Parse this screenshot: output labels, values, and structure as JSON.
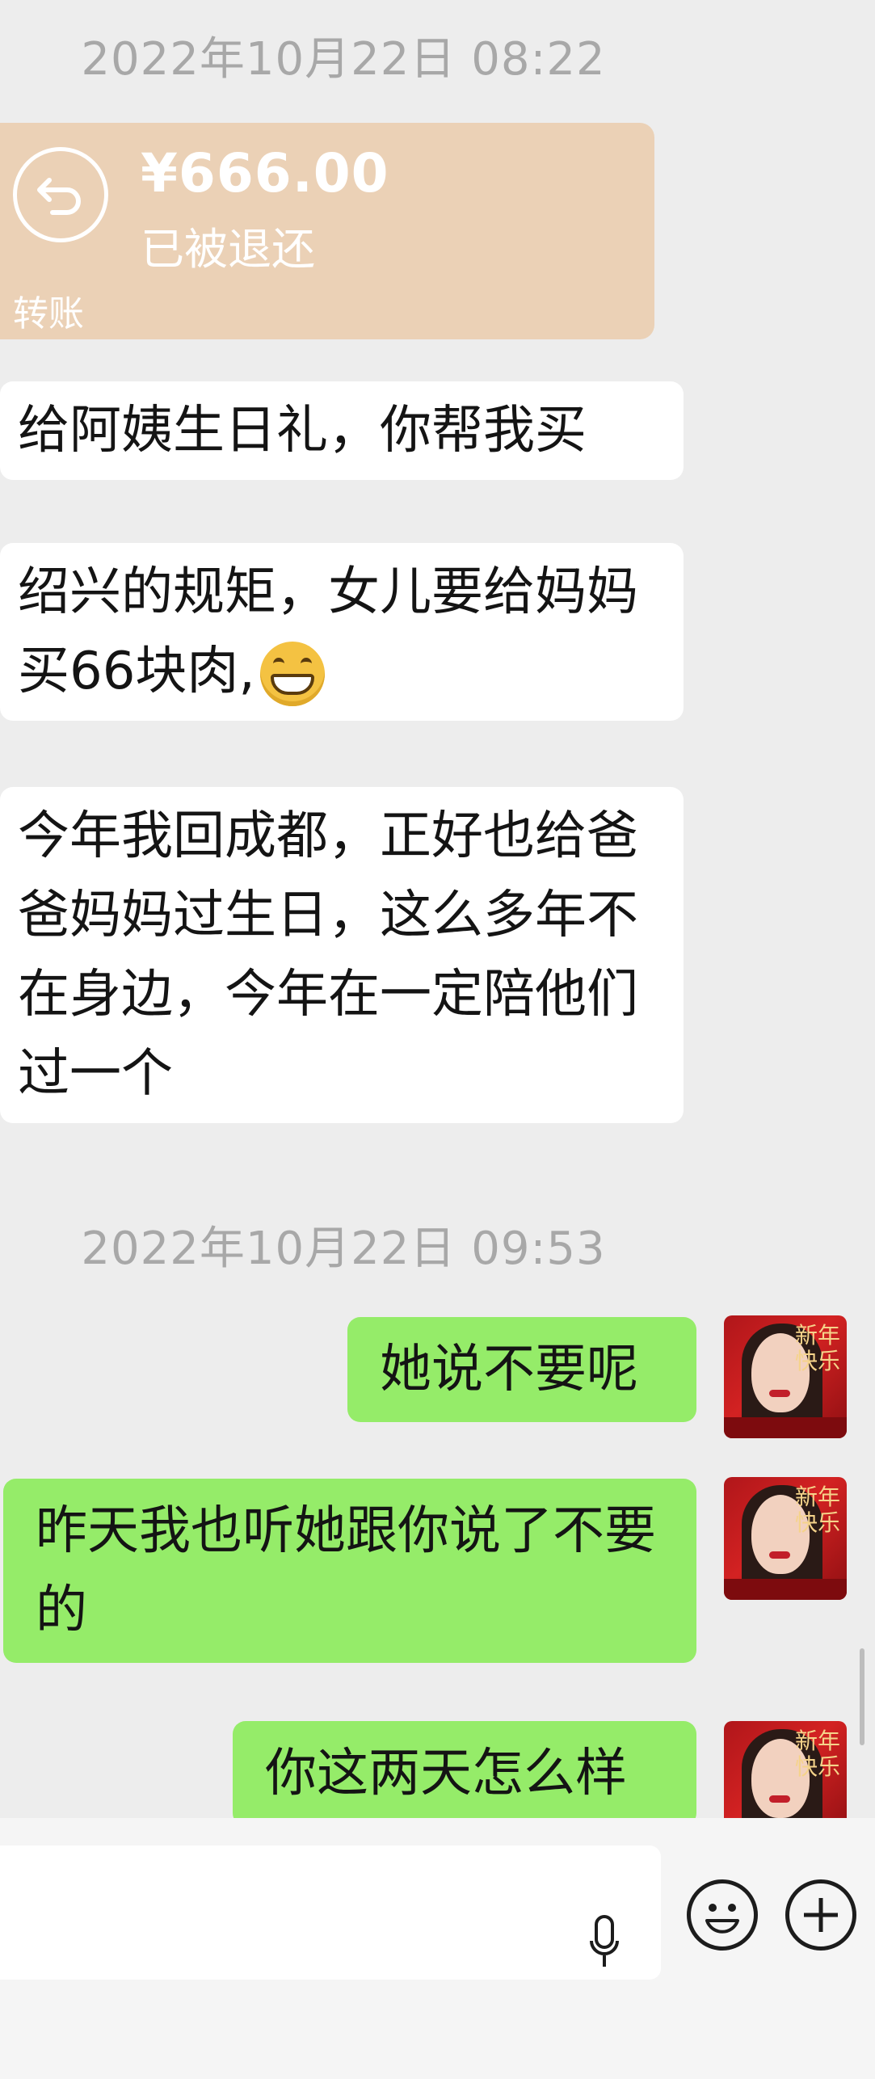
{
  "chat": {
    "timestamp1": "2022年10月22日 08:22",
    "timestamp2": "2022年10月22日 09:53",
    "transfer": {
      "amount": "¥666.00",
      "status": "已被退还",
      "label": "转账"
    },
    "incoming": [
      "给阿姨生日礼，你帮我买",
      "绍兴的规矩，女儿要给妈妈买66块肉,",
      "今年我回成都，正好也给爸爸妈妈过生日，这么多年不在身边，今年在一定陪他们过一个"
    ],
    "outgoing": [
      "她说不要呢",
      "昨天我也听她跟你说了不要的",
      "你这两天怎么样"
    ],
    "avatar_text": [
      "新年",
      "快乐"
    ]
  },
  "icons": {
    "transfer_return": "return-arrow-icon",
    "grin_emoji": "grinning-emoji-icon",
    "mic": "microphone-icon",
    "emoji_button": "smiley-icon",
    "add_button": "plus-icon"
  },
  "colors": {
    "background": "#ededed",
    "outgoing_bubble": "#95ec69",
    "incoming_bubble": "#ffffff",
    "transfer_card": "#ebd1b6"
  }
}
